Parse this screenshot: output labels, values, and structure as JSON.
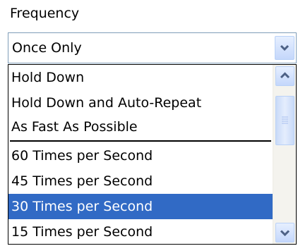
{
  "field": {
    "label": "Frequency",
    "selected_value": "Once Only"
  },
  "dropdown": {
    "items": [
      {
        "label": "Hold Down",
        "selected": false
      },
      {
        "label": "Hold Down and Auto-Repeat",
        "selected": false
      },
      {
        "label": "As Fast As Possible",
        "selected": false
      },
      {
        "label": "60 Times per Second",
        "selected": false
      },
      {
        "label": "45 Times per Second",
        "selected": false
      },
      {
        "label": "30 Times per Second",
        "selected": true
      },
      {
        "label": "15 Times per Second",
        "selected": false
      }
    ]
  },
  "icons": {
    "dropdown_arrow": "chevron-down-icon",
    "scroll_up": "chevron-up-icon",
    "scroll_down": "chevron-down-icon"
  },
  "colors": {
    "highlight": "#316ac5",
    "highlight_text": "#ffffff",
    "arrow": "#4d6185"
  }
}
